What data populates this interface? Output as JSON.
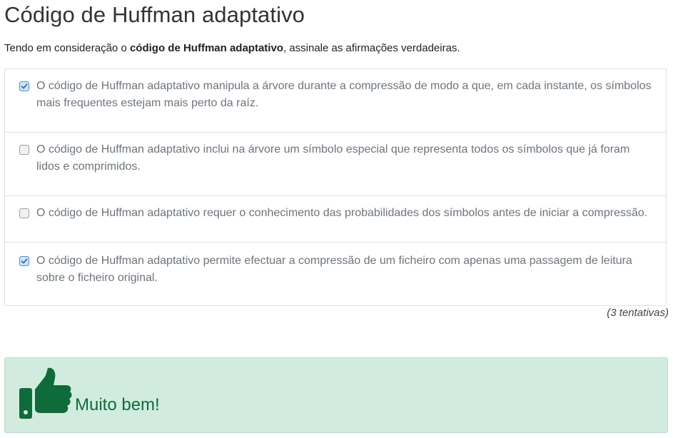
{
  "page": {
    "title": "Código de Huffman adaptativo",
    "prompt_before": "Tendo em consideração o ",
    "prompt_bold": "código de Huffman adaptativo",
    "prompt_after": ", assinale as afirmações verdadeiras."
  },
  "options": [
    {
      "checked": true,
      "text": "O código de Huffman adaptativo manipula a árvore durante a compressão de modo a que, em cada instante, os símbolos mais frequentes estejam mais perto da raíz."
    },
    {
      "checked": false,
      "text": "O código de Huffman adaptativo inclui na árvore um símbolo especial que representa todos os símbolos que já foram lidos e comprimidos."
    },
    {
      "checked": false,
      "text": "O código de Huffman adaptativo requer o conhecimento das probabilidades dos símbolos antes de iniciar a compressão."
    },
    {
      "checked": true,
      "text": "O código de Huffman adaptativo permite efectuar a compressão de um ficheiro com apenas uma passagem de leitura sobre o ficheiro original."
    }
  ],
  "attempts": "(3 tentativas)",
  "feedback": {
    "icon": "thumbs-up-icon",
    "message": "Muito bem!",
    "color": "#0f6b3a",
    "background": "#d1ecdf"
  }
}
